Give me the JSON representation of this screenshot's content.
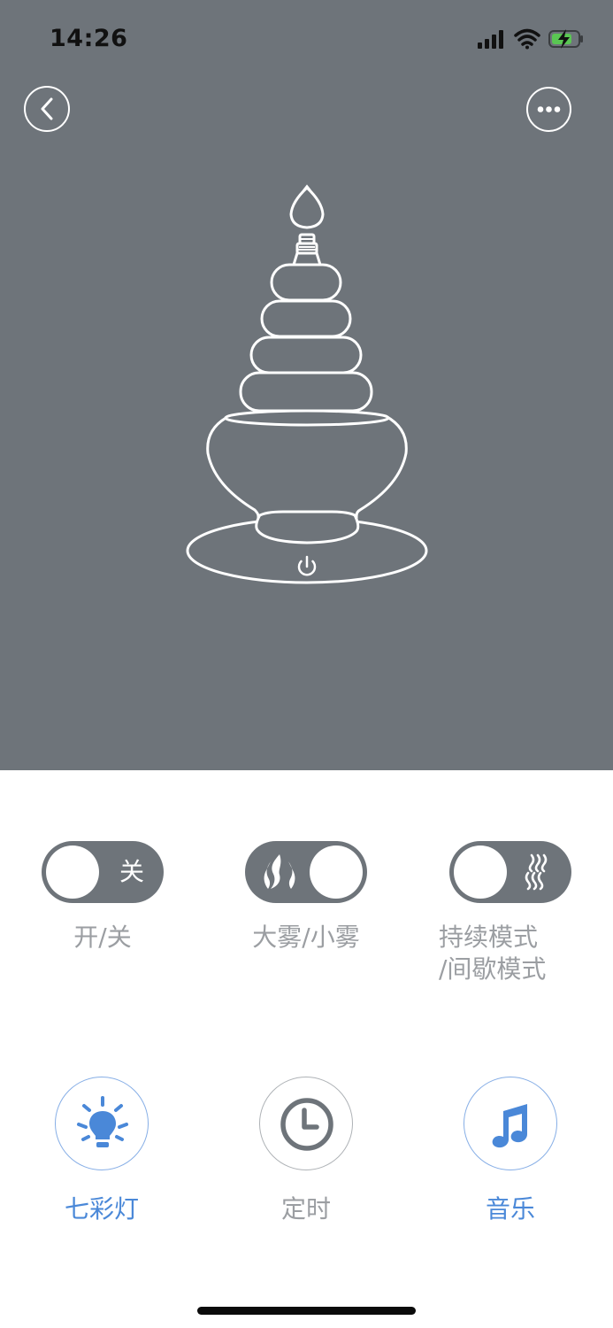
{
  "status_bar": {
    "time": "14:26"
  },
  "controls": [
    {
      "state_text": "关",
      "label": "开/关"
    },
    {
      "label": "大雾/小雾"
    },
    {
      "label_line1": "持续模式",
      "label_line2": "/间歇模式"
    }
  ],
  "features": [
    {
      "label": "七彩灯",
      "icon": "light-bulb-icon",
      "color": "#4a88d8"
    },
    {
      "label": "定时",
      "icon": "clock-icon",
      "color": "#9b9ea2"
    },
    {
      "label": "音乐",
      "icon": "music-note-icon",
      "color": "#4a88d8"
    }
  ],
  "colors": {
    "hero_bg": "#6e747a",
    "accent": "#4a88d8",
    "muted": "#9b9ea2",
    "toggle_bg": "#6e747a"
  }
}
